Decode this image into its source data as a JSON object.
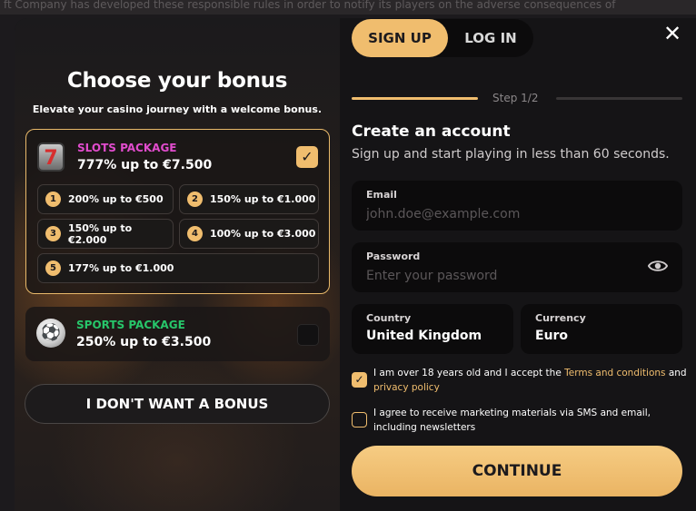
{
  "background_text": "ft Company has developed these responsible rules in order to notify its players on the adverse consequences of",
  "bonus": {
    "title": "Choose your bonus",
    "subtitle": "Elevate your casino journey with a welcome bonus.",
    "slots": {
      "name": "SLOTS PACKAGE",
      "amount": "777% up to €7.500",
      "icon": "slot-7-icon",
      "selected": true,
      "tiers": [
        {
          "num": "1",
          "label": "200% up to €500"
        },
        {
          "num": "2",
          "label": "150% up to €1.000"
        },
        {
          "num": "3",
          "label": "150% up to €2.000"
        },
        {
          "num": "4",
          "label": "100% up to €3.000"
        },
        {
          "num": "5",
          "label": "177% up to €1.000"
        }
      ]
    },
    "sports": {
      "name": "SPORTS PACKAGE",
      "amount": "250% up to €3.500",
      "icon": "soccer-ball-icon",
      "selected": false
    },
    "no_bonus_label": "I DON'T WANT A BONUS"
  },
  "tabs": {
    "signup": "SIGN UP",
    "login": "LOG IN"
  },
  "step": {
    "label": "Step 1/2",
    "current": 1,
    "total": 2
  },
  "form": {
    "title": "Create an account",
    "subtitle": "Sign up and start playing in less than 60 seconds.",
    "email": {
      "label": "Email",
      "placeholder": "john.doe@example.com",
      "value": ""
    },
    "password": {
      "label": "Password",
      "placeholder": "Enter your password",
      "value": ""
    },
    "country": {
      "label": "Country",
      "value": "United Kingdom"
    },
    "currency": {
      "label": "Currency",
      "value": "Euro"
    },
    "age_consent": {
      "checked": true,
      "text_1": "I am over 18 years old and I accept the ",
      "link_terms": "Terms and conditions",
      "text_2": " and ",
      "link_privacy": "privacy policy"
    },
    "marketing_consent": {
      "checked": false,
      "text": "I agree to receive marketing materials via SMS and email, including newsletters"
    },
    "continue_label": "CONTINUE"
  },
  "colors": {
    "accent": "#f0bd6e",
    "slots_name": "#e14ccd",
    "sports_name": "#27c66a",
    "field_bg": "#0c0b0c"
  }
}
